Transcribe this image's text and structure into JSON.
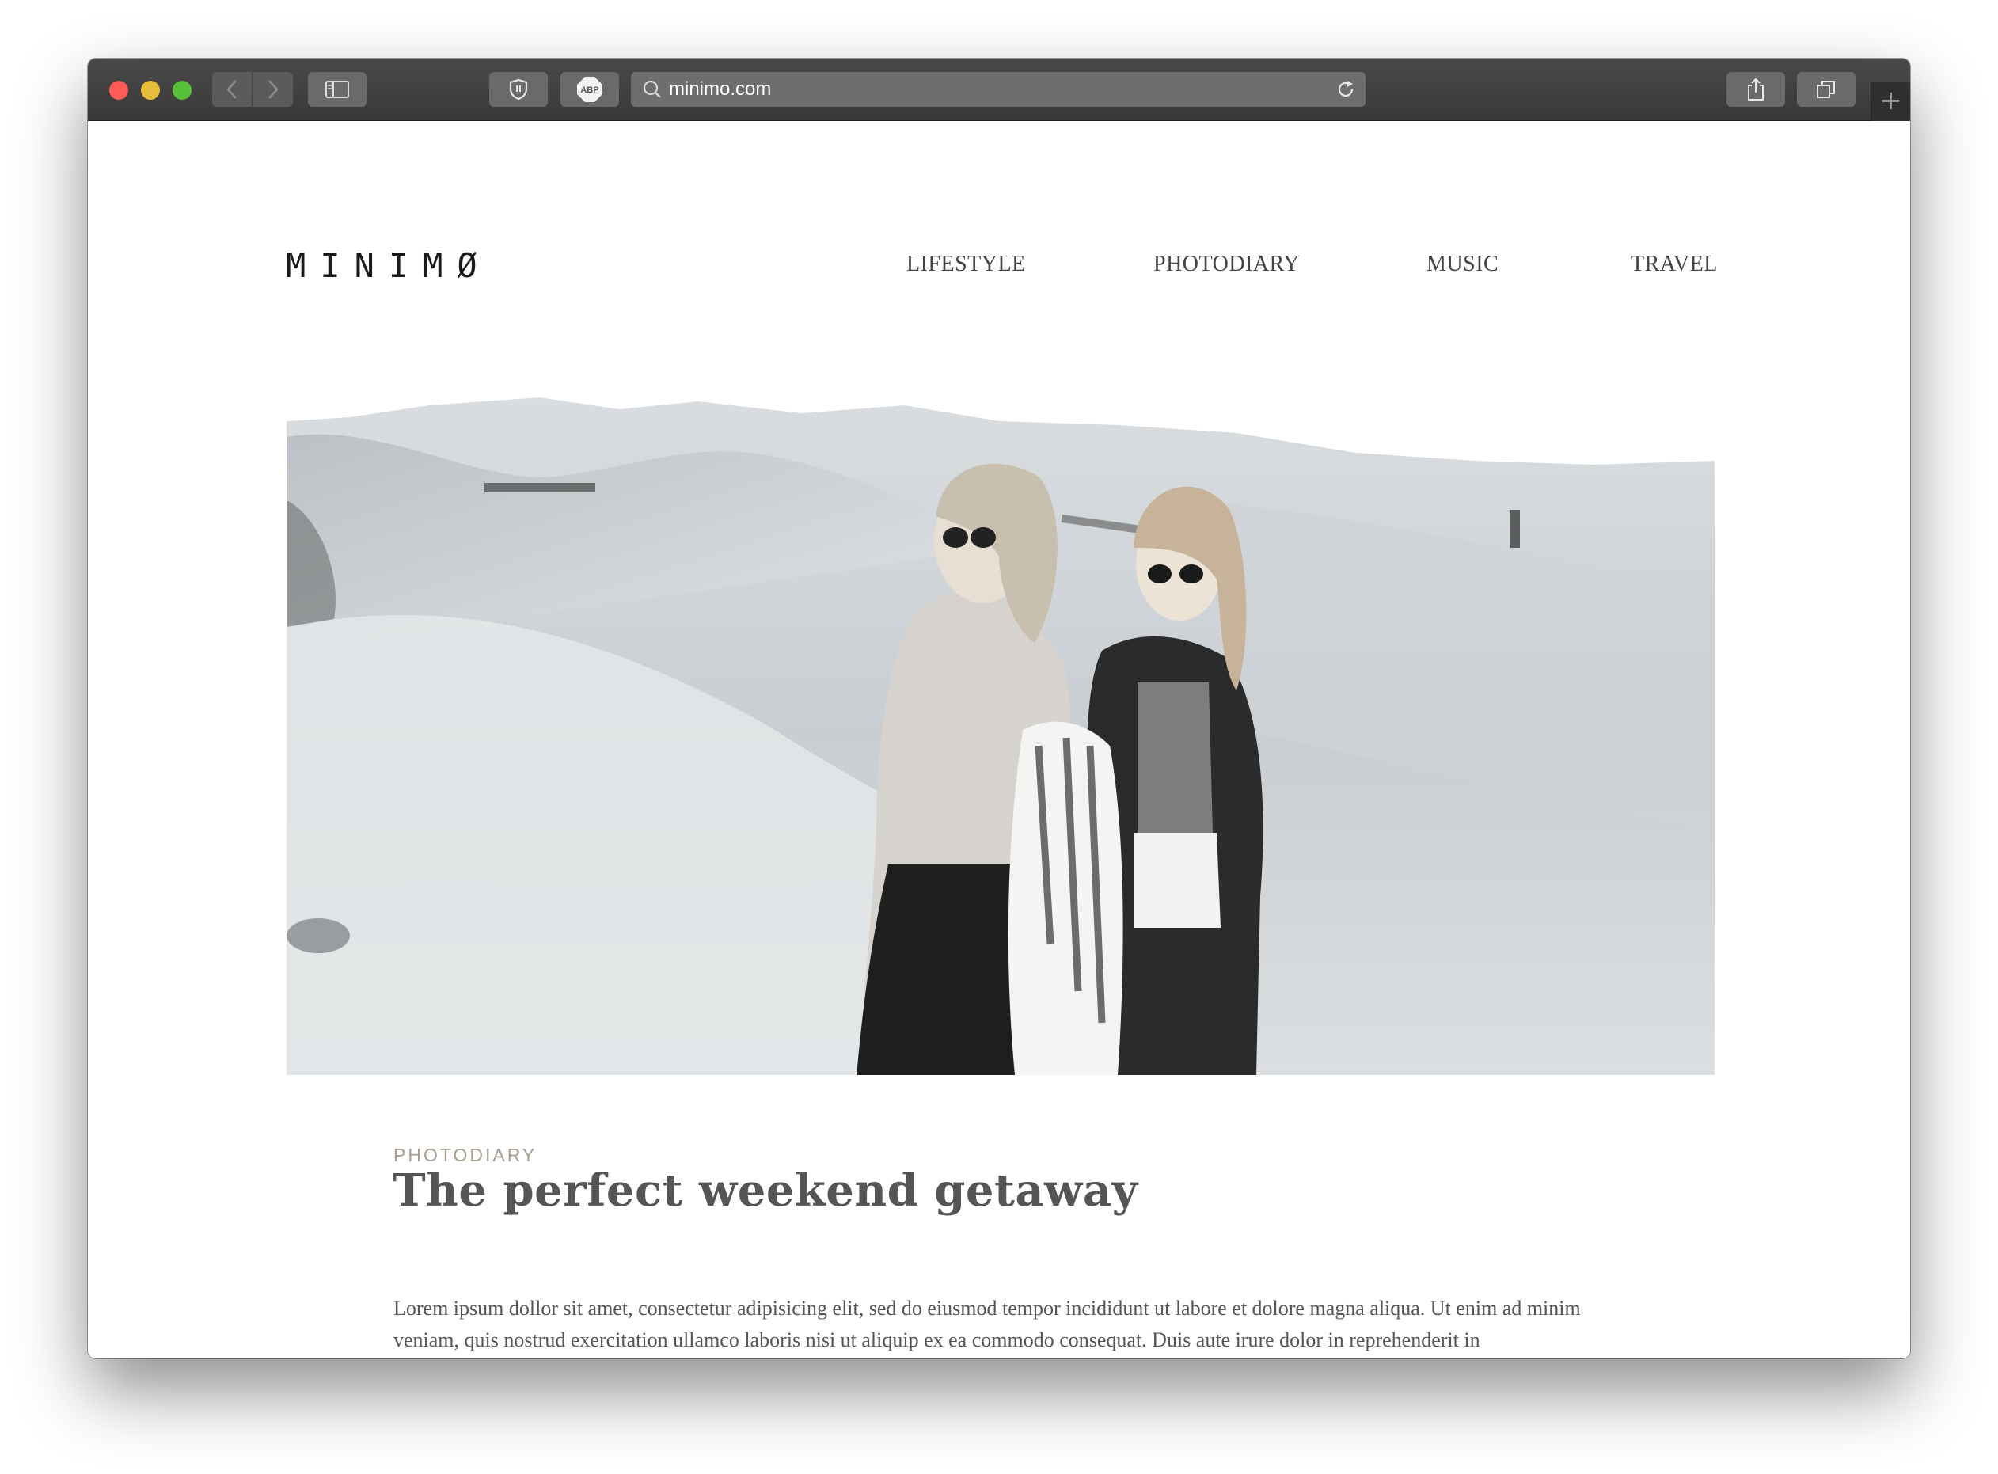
{
  "browser": {
    "url": "minimo.com",
    "colors": {
      "close": "#fc5b57",
      "minimize": "#e5bf3c",
      "maximize": "#57c038"
    },
    "icons": [
      "back-icon",
      "forward-icon",
      "sidebar-icon",
      "shield-icon",
      "adblock-icon",
      "search-icon",
      "reload-icon",
      "share-icon",
      "tabs-icon",
      "new-tab-icon"
    ],
    "adblock_label": "ABP",
    "newtab_label": "+"
  },
  "site": {
    "logo": "MINIMØ",
    "nav": [
      "LIFESTYLE",
      "PHOTODIARY",
      "MUSIC",
      "TRAVEL"
    ]
  },
  "article": {
    "category": "PHOTODIARY",
    "title": "The perfect weekend getaway",
    "body": "Lorem ipsum dollor sit amet, consectetur adipisicing elit, sed do eiusmod tempor incididunt ut labore et dolore magna aliqua. Ut enim ad minim veniam, quis nostrud exercitation ullamco laboris nisi ut aliquip ex ea commodo consequat. Duis aute irure dolor in reprehenderit in"
  }
}
